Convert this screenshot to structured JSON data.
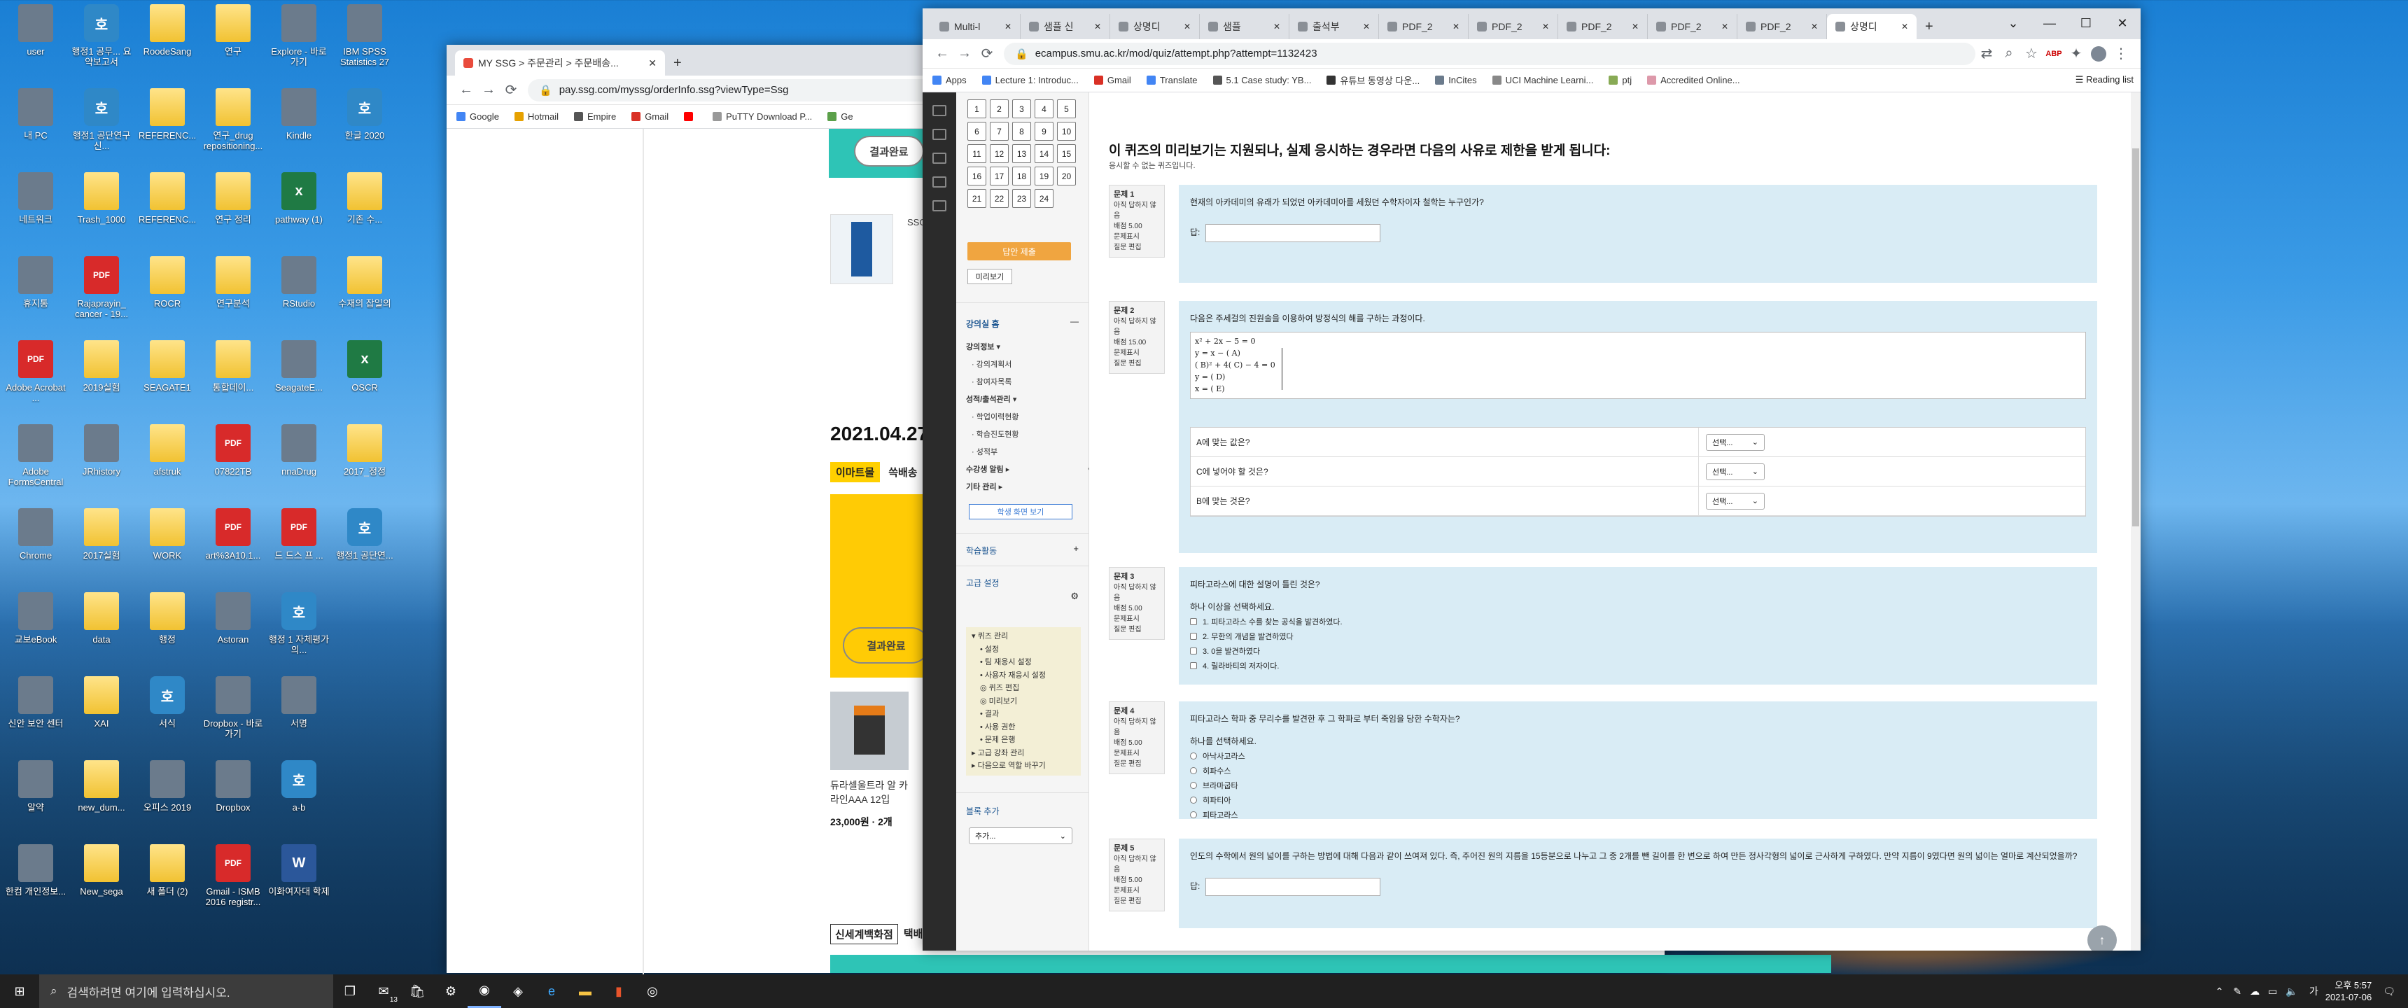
{
  "desktop": {
    "icons": [
      {
        "label": "user",
        "kind": "misc",
        "col": 0,
        "row": 0
      },
      {
        "label": "행정1 공무... 요약보고서",
        "kind": "hwp",
        "col": 1,
        "row": 0
      },
      {
        "label": "RoodeSang",
        "kind": "folder",
        "col": 2,
        "row": 0
      },
      {
        "label": "연구",
        "kind": "folder",
        "col": 3,
        "row": 0
      },
      {
        "label": "Explore - 바로 가기",
        "kind": "misc",
        "col": 4,
        "row": 0
      },
      {
        "label": "IBM SPSS Statistics 27",
        "kind": "misc",
        "col": 5,
        "row": 0
      },
      {
        "label": "내 PC",
        "kind": "misc",
        "col": 0,
        "row": 1
      },
      {
        "label": "행정1 공단연구 신...",
        "kind": "hwp",
        "col": 1,
        "row": 1
      },
      {
        "label": "REFERENC...",
        "kind": "folder",
        "col": 2,
        "row": 1
      },
      {
        "label": "연구_drug repositioning...",
        "kind": "folder",
        "col": 3,
        "row": 1
      },
      {
        "label": "Kindle",
        "kind": "misc",
        "col": 4,
        "row": 1
      },
      {
        "label": "한글 2020",
        "kind": "hwp",
        "col": 5,
        "row": 1
      },
      {
        "label": "네트워크",
        "kind": "misc",
        "col": 0,
        "row": 2
      },
      {
        "label": "Trash_1000",
        "kind": "folder",
        "col": 1,
        "row": 2
      },
      {
        "label": "REFERENC...",
        "kind": "folder",
        "col": 2,
        "row": 2
      },
      {
        "label": "연구 정리",
        "kind": "folder",
        "col": 3,
        "row": 2
      },
      {
        "label": "pathway (1)",
        "kind": "xls",
        "col": 4,
        "row": 2
      },
      {
        "label": "기존 수...",
        "kind": "folder",
        "col": 5,
        "row": 2
      },
      {
        "label": "휴지통",
        "kind": "misc",
        "col": 0,
        "row": 3
      },
      {
        "label": "Rajaprayin_ cancer - 19...",
        "kind": "pdf",
        "col": 1,
        "row": 3
      },
      {
        "label": "ROCR",
        "kind": "folder",
        "col": 2,
        "row": 3
      },
      {
        "label": "연구분석",
        "kind": "folder",
        "col": 3,
        "row": 3
      },
      {
        "label": "RStudio",
        "kind": "misc",
        "col": 4,
        "row": 3
      },
      {
        "label": "수재의 잡일의",
        "kind": "folder",
        "col": 5,
        "row": 3
      },
      {
        "label": "Adobe Acrobat ...",
        "kind": "pdf",
        "col": 0,
        "row": 4
      },
      {
        "label": "2019실험",
        "kind": "folder",
        "col": 1,
        "row": 4
      },
      {
        "label": "SEAGATE1",
        "kind": "folder",
        "col": 2,
        "row": 4
      },
      {
        "label": "통합데이...",
        "kind": "folder",
        "col": 3,
        "row": 4
      },
      {
        "label": "SeagateE...",
        "kind": "misc",
        "col": 4,
        "row": 4
      },
      {
        "label": "OSCR",
        "kind": "xls",
        "col": 5,
        "row": 4
      },
      {
        "label": "Adobe FormsCentral",
        "kind": "misc",
        "col": 0,
        "row": 5
      },
      {
        "label": "JRhistory",
        "kind": "misc",
        "col": 1,
        "row": 5
      },
      {
        "label": "afstruk",
        "kind": "folder",
        "col": 2,
        "row": 5
      },
      {
        "label": "07822TB",
        "kind": "pdf",
        "col": 3,
        "row": 5
      },
      {
        "label": "nnaDrug",
        "kind": "misc",
        "col": 4,
        "row": 5
      },
      {
        "label": "2017_정정",
        "kind": "folder",
        "col": 5,
        "row": 5
      },
      {
        "label": "Chrome",
        "kind": "misc",
        "col": 0,
        "row": 6
      },
      {
        "label": "2017실험",
        "kind": "folder",
        "col": 1,
        "row": 6
      },
      {
        "label": "WORK",
        "kind": "folder",
        "col": 2,
        "row": 6
      },
      {
        "label": "art%3A10.1...",
        "kind": "pdf",
        "col": 3,
        "row": 6
      },
      {
        "label": "드 드스 프 ...",
        "kind": "pdf",
        "col": 4,
        "row": 6
      },
      {
        "label": "행정1 공단연...",
        "kind": "hwp",
        "col": 5,
        "row": 6
      },
      {
        "label": "교보eBook",
        "kind": "misc",
        "col": 0,
        "row": 7
      },
      {
        "label": "data",
        "kind": "folder",
        "col": 1,
        "row": 7
      },
      {
        "label": "행정",
        "kind": "folder",
        "col": 2,
        "row": 7
      },
      {
        "label": "Astoran",
        "kind": "misc",
        "col": 3,
        "row": 7
      },
      {
        "label": "행정 1 자체평가의...",
        "kind": "hwp",
        "col": 4,
        "row": 7
      },
      {
        "label": "신안 보안 센터",
        "kind": "misc",
        "col": 0,
        "row": 8
      },
      {
        "label": "XAI",
        "kind": "folder",
        "col": 1,
        "row": 8
      },
      {
        "label": "서식",
        "kind": "hwp",
        "col": 2,
        "row": 8
      },
      {
        "label": "Dropbox - 바로 가기",
        "kind": "misc",
        "col": 3,
        "row": 8
      },
      {
        "label": "서명",
        "kind": "misc",
        "col": 4,
        "row": 8
      },
      {
        "label": "알약",
        "kind": "misc",
        "col": 0,
        "row": 9
      },
      {
        "label": "new_dum...",
        "kind": "folder",
        "col": 1,
        "row": 9
      },
      {
        "label": "오피스 2019",
        "kind": "misc",
        "col": 2,
        "row": 9
      },
      {
        "label": "Dropbox",
        "kind": "misc",
        "col": 3,
        "row": 9
      },
      {
        "label": "a-b",
        "kind": "hwp",
        "col": 4,
        "row": 9
      },
      {
        "label": "한컴 개인정보...",
        "kind": "misc",
        "col": 0,
        "row": 10
      },
      {
        "label": "New_sega",
        "kind": "folder",
        "col": 1,
        "row": 10
      },
      {
        "label": "새 폴더 (2)",
        "kind": "folder",
        "col": 2,
        "row": 10
      },
      {
        "label": "Gmail - ISMB 2016 registr...",
        "kind": "pdf",
        "col": 3,
        "row": 10
      },
      {
        "label": "이화여자대 학제",
        "kind": "word",
        "col": 4,
        "row": 10
      }
    ]
  },
  "ssg": {
    "tab_title": "MY SSG > 주문관리 > 주문배송...",
    "url": "pay.ssg.com/myssg/orderInfo.ssg?viewType=Ssg",
    "bookmarks": [
      "Google",
      "Hotmail",
      "Empire",
      "Gmail",
      "",
      "PuTTY Download P...",
      "Ge"
    ],
    "date": "2021.04.27",
    "tag1": "이마트몰",
    "tag2": "쓱배송",
    "btn_top": "결과완료",
    "btn_mid": "결과완료",
    "product_name": "듀라셀울트라 알 카라인AAA 12입",
    "price": "23,000원 · 2개",
    "ssg_small": "SSG",
    "footer_tag1": "신세계백화점",
    "footer_tag2": "택배"
  },
  "moodle": {
    "tabs": [
      "Multi-l",
      "샘플 신",
      "상명디",
      "샘플",
      "출석부",
      "PDF_2",
      "PDF_2",
      "PDF_2",
      "PDF_2",
      "PDF_2",
      "상명디"
    ],
    "url": "ecampus.smu.ac.kr/mod/quiz/attempt.php?attempt=1132423",
    "bookmarks": [
      "Apps",
      "Lecture 1: Introduc...",
      "Gmail",
      "Translate",
      "5.1 Case study: YB...",
      "유튜브 동영상 다운...",
      "InCites",
      "UCI Machine Learni...",
      "ptj",
      "Accredited Online..."
    ],
    "reading_list": "Reading list",
    "heading": "이 퀴즈의 미리보기는 지원되나, 실제 응시하는 경우라면 다음의 사유로 제한을 받게 됩니다:",
    "subheading": "응시할 수 없는 퀴즈입니다.",
    "nav_numbers": [
      "1",
      "2",
      "3",
      "4",
      "5",
      "6",
      "7",
      "8",
      "9",
      "10",
      "11",
      "12",
      "13",
      "14",
      "15",
      "16",
      "17",
      "18",
      "19",
      "20",
      "21",
      "22",
      "23",
      "24"
    ],
    "finish_button": "답안 제출",
    "preview_button": "미리보기",
    "drawer": {
      "section1": "강의실 홈",
      "s1_items": [
        "강의정보 ▾",
        "· 강의계획서",
        "· 참여자목록",
        "성적/출석관리 ▾",
        "· 학업이력현황",
        "· 학습진도현황",
        "· 성적부",
        "수강생 알림 ▸",
        "기타 관리 ▸"
      ],
      "student_view": "학생 화면 보기",
      "section2": "학습활동",
      "section3": "고급 설정",
      "s3_items": [
        "▾ 퀴즈 관리",
        "• 설정",
        "• 팀 재응시 설정",
        "• 사용자 재응시 설정",
        "◎ 퀴즈 편집",
        "◎ 미리보기",
        "• 결과",
        "• 사용 권한",
        "• 문제 은행",
        "▸ 고급 강좌 관리",
        "▸ 다음으로 역할 바꾸기"
      ],
      "section4": "블록 추가",
      "add_select": "추가..."
    },
    "questions": [
      {
        "label": "문제 1",
        "meta": [
          "아직 답하지 않음",
          "배점 5.00",
          "문제표시",
          "질문 편집"
        ],
        "text": "현재의 아카데미의 유래가 되었던 아카데미아를 세웠던 수학자이자 철학는 누구인가?",
        "answer_label": "답:"
      },
      {
        "label": "문제 2",
        "meta": [
          "아직 답하지 않음",
          "배점 15.00",
          "문제표시",
          "질문 편집"
        ],
        "text": "다음은 주세걸의 진원술을 이용하여 방정식의 해를 구하는 과정이다.",
        "eq": [
          "x² + 2x − 5 = 0",
          "y = x − (   A)",
          "(   B)² + 4(   C) − 4 = 0",
          "y = (   D)",
          "x = (   E)"
        ],
        "rows": [
          {
            "q": "A에 맞는 값은?",
            "sel": "선택..."
          },
          {
            "q": "C에 넣어야 할 것은?",
            "sel": "선택..."
          },
          {
            "q": "B에 맞는 것은?",
            "sel": "선택..."
          }
        ]
      },
      {
        "label": "문제 3",
        "meta": [
          "아직 답하지 않음",
          "배점 5.00",
          "문제표시",
          "질문 편집"
        ],
        "text": "피타고라스에 대한 설명이 틀린 것은?",
        "prompt": "하나 이상을 선택하세요.",
        "options": [
          "1. 피타고라스 수를 찾는 공식을 발견하였다.",
          "2. 무한의 개념을 발견하였다",
          "3. 0을 발견하였다",
          "4. 릴라바티의 저자이다."
        ]
      },
      {
        "label": "문제 4",
        "meta": [
          "아직 답하지 않음",
          "배점 5.00",
          "문제표시",
          "질문 편집"
        ],
        "text": "피타고라스 학파 중 무리수를 발견한 후 그 학파로 부터 죽임을 당한 수학자는?",
        "prompt": "하나를 선택하세요.",
        "options": [
          "아낙사고라스",
          "히파수스",
          "브라마굽타",
          "히파티아",
          "피타고라스"
        ]
      },
      {
        "label": "문제 5",
        "meta": [
          "아직 답하지 않음",
          "배점 5.00",
          "문제표시",
          "질문 편집"
        ],
        "text": "인도의 수학에서 원의 넓이를 구하는 방법에 대해 다음과 같이 쓰여져 있다. 즉, 주어진 원의 지름을 15등분으로 나누고 그 중 2개를 뺀 길이를 한 변으로 하여 만든 정사각형의 넓이로 근사하게 구하였다. 만약 지름이 9였다면 원의 넓이는 얼마로 계산되었을까?",
        "answer_label": "답:"
      }
    ]
  },
  "taskbar": {
    "search_placeholder": "검색하려면 여기에 입력하십시오.",
    "time": "오후 5:57",
    "date": "2021-07-06",
    "mail_badge": "13"
  }
}
